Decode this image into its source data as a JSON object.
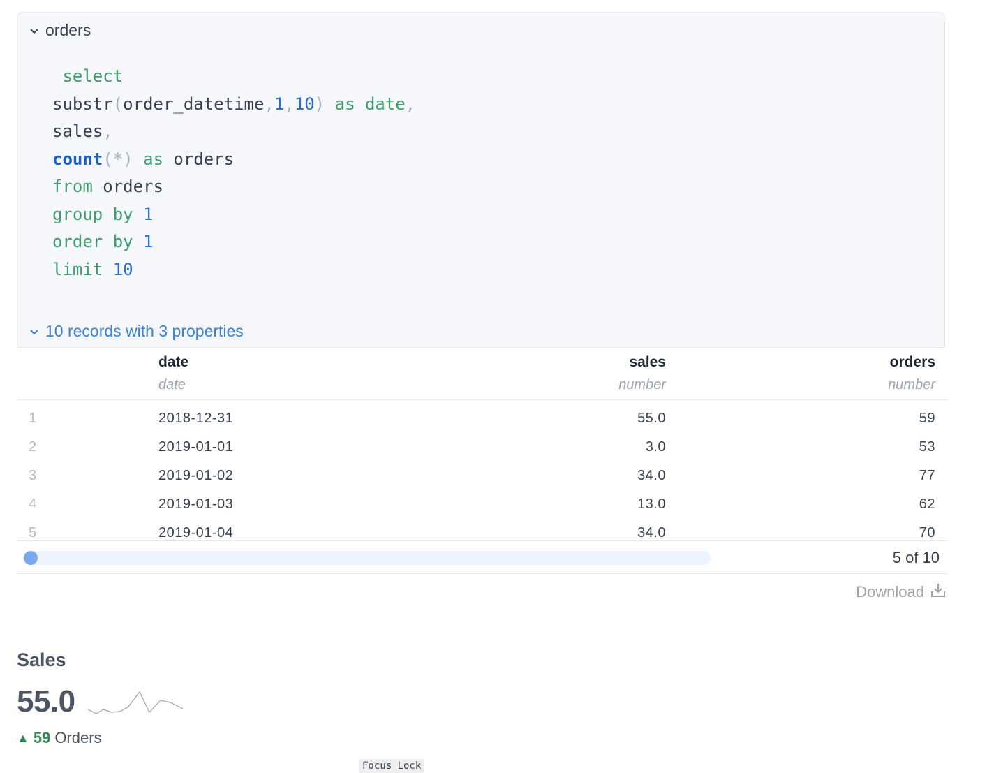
{
  "query": {
    "name": "orders",
    "records_summary": "10 records with 3 properties"
  },
  "table": {
    "columns": [
      {
        "name": "date",
        "type": "date"
      },
      {
        "name": "sales",
        "type": "number"
      },
      {
        "name": "orders",
        "type": "number"
      }
    ],
    "rows": [
      {
        "n": "1",
        "date": "2018-12-31",
        "sales": "55.0",
        "orders": "59"
      },
      {
        "n": "2",
        "date": "2019-01-01",
        "sales": "3.0",
        "orders": "53"
      },
      {
        "n": "3",
        "date": "2019-01-02",
        "sales": "34.0",
        "orders": "77"
      },
      {
        "n": "4",
        "date": "2019-01-03",
        "sales": "13.0",
        "orders": "62"
      },
      {
        "n": "5",
        "date": "2019-01-04",
        "sales": "34.0",
        "orders": "70"
      }
    ]
  },
  "pagination": {
    "label": "5 of 10",
    "position": 0
  },
  "download": {
    "label": "Download",
    "icon": "download-icon"
  },
  "big_value": {
    "title": "Sales",
    "value": "55.0",
    "delta_arrow": "▲",
    "delta_value": "59",
    "delta_label": "Orders"
  },
  "focus_lock_label": "Focus Lock",
  "colors": {
    "keyword": "#3f9d6b",
    "function": "#1f5fbf",
    "number": "#2a6fd1",
    "link": "#3b82d6",
    "positive": "#2f8a57",
    "slider_thumb": "#7aa9ee"
  }
}
